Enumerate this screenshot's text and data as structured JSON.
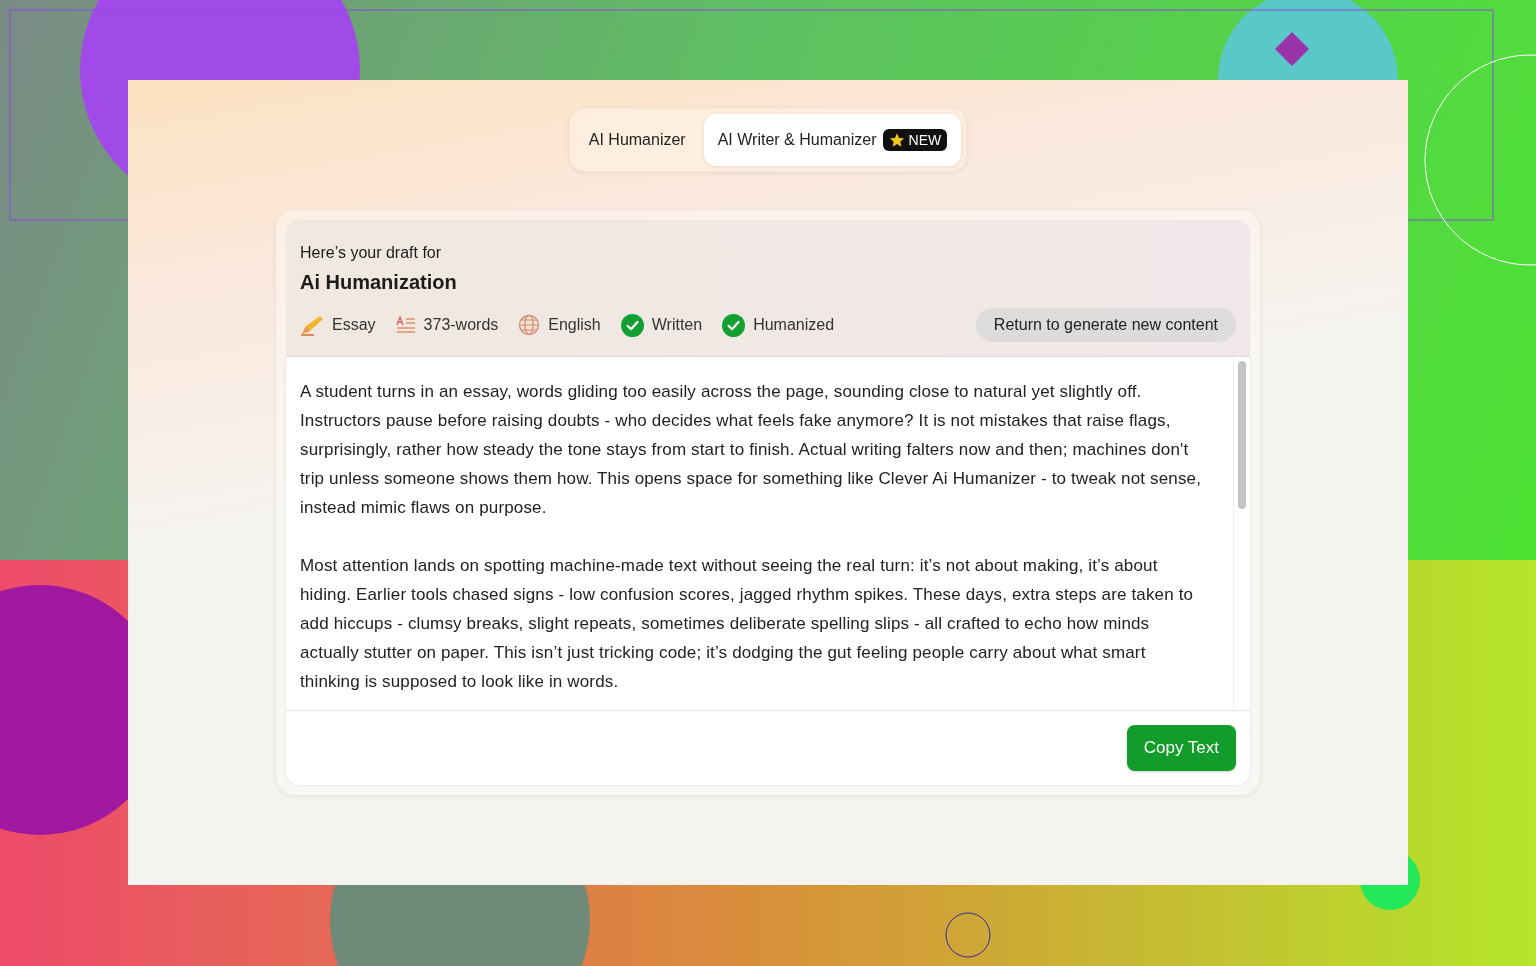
{
  "tabs": [
    {
      "label": "AI Humanizer",
      "selected": false
    },
    {
      "label": "AI Writer & Humanizer",
      "selected": true,
      "badge": "NEW"
    }
  ],
  "draft": {
    "intro": "Here’s your draft for",
    "title": "Ai Humanization",
    "meta": [
      {
        "kind": "essay",
        "label": "Essay"
      },
      {
        "kind": "words",
        "label": "373-words"
      },
      {
        "kind": "language",
        "label": "English"
      },
      {
        "kind": "check",
        "label": "Written"
      },
      {
        "kind": "check",
        "label": "Humanized"
      }
    ],
    "return_button": "Return to generate new content",
    "paragraphs": [
      "A student turns in an essay, words gliding too easily across the page, sounding close to natural yet slightly off. Instructors pause before raising doubts - who decides what feels fake anymore? It is not mistakes that raise flags, surprisingly, rather how steady the tone stays from start to finish. Actual writing falters now and then; machines don't trip unless someone shows them how. This opens space for something like Clever Ai Humanizer - to tweak not sense, instead mimic flaws on purpose.",
      "Most attention lands on spotting machine-made text without seeing the real turn: it’s not about making, it’s about hiding. Earlier tools chased signs - low confusion scores, jagged rhythm spikes. These days, extra steps are taken to add hiccups - clumsy breaks, slight repeats, sometimes deliberate spelling slips - all crafted to echo how minds actually stutter on paper. This isn’t just tricking code; it’s dodging the gut feeling people carry about what smart thinking is supposed to look like in words."
    ],
    "copy_button": "Copy Text"
  }
}
